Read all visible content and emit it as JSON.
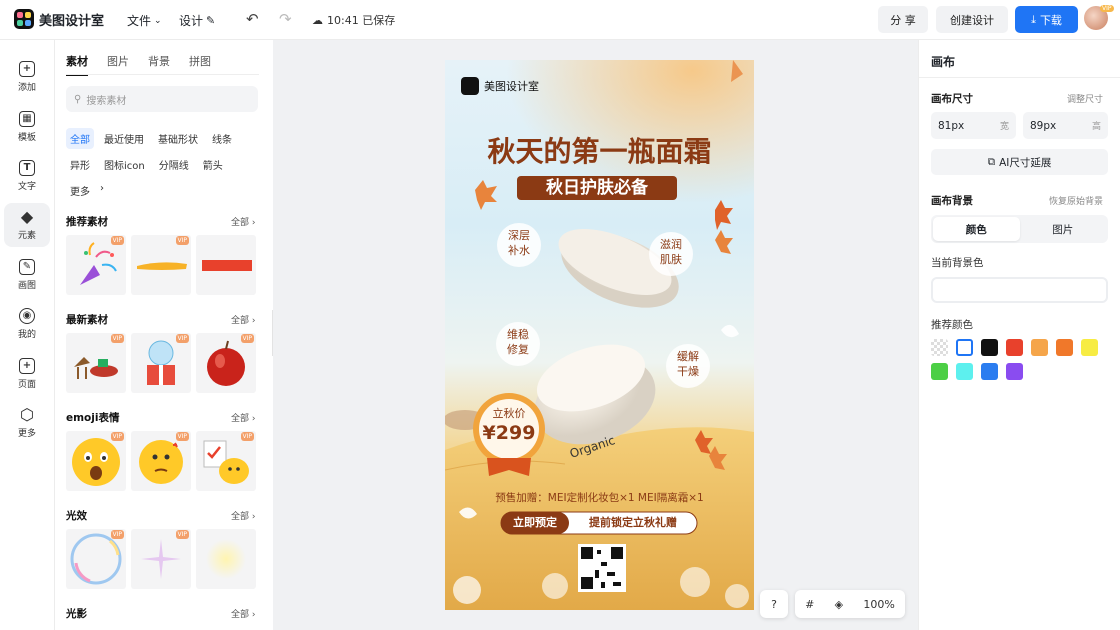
{
  "topbar": {
    "app_name": "美图设计室",
    "menu_file": "文件",
    "menu_design": "设计",
    "save_status": "10:41 已保存",
    "share_label": "分 享",
    "create_label": "创建设计",
    "download_label": "下载",
    "avatar_badge": "VIP"
  },
  "leftnav": {
    "items": [
      {
        "label": "添加",
        "icon": "+"
      },
      {
        "label": "模板",
        "icon": "▦"
      },
      {
        "label": "文字",
        "icon": "T"
      },
      {
        "label": "元素",
        "icon": "◆"
      },
      {
        "label": "画图",
        "icon": "✎"
      },
      {
        "label": "我的",
        "icon": "◉"
      },
      {
        "label": "页面",
        "icon": "+"
      },
      {
        "label": "更多",
        "icon": "⬡"
      }
    ]
  },
  "panel": {
    "tabs": [
      "素材",
      "图片",
      "背景",
      "拼图"
    ],
    "search_placeholder": "搜索素材",
    "chips_row1": [
      "全部",
      "最近使用",
      "基础形状",
      "线条"
    ],
    "chips_row2": [
      "异形",
      "图标icon",
      "分隔线",
      "箭头"
    ],
    "chips_more": "更多",
    "all_label": "全部",
    "vip": "VIP",
    "sections": [
      "推荐素材",
      "最新素材",
      "emoji表情",
      "光效",
      "光影"
    ]
  },
  "poster": {
    "brand": "美图设计室",
    "headline": "秋天的第一瓶面霜",
    "subheadline": "秋日护肤必备",
    "bubbles": [
      "深层\n补水",
      "滋润\n肌肤",
      "维稳\n修复",
      "缓解\n干燥"
    ],
    "price_label": "立秋价",
    "price": "¥299",
    "jar_text": "Organic",
    "presale": "预售加赠：MEI定制化妆包×1  MEI隔离霜×1",
    "cta_left": "立即预定",
    "cta_right": "提前锁定立秋礼赠"
  },
  "float_bar": {
    "help": "?",
    "zoom": "100%"
  },
  "rightpanel": {
    "title": "画布",
    "size_label": "画布尺寸",
    "size_adjust": "调整尺寸",
    "width_value": "81px",
    "width_unit": "宽",
    "height_value": "89px",
    "height_unit": "高",
    "ai_extend": "AI尺寸延展",
    "bg_label": "画布背景",
    "bg_restore": "恢复原始背景",
    "seg_color": "颜色",
    "seg_image": "图片",
    "current_bg": "当前背景色",
    "recommended": "推荐颜色",
    "swatches": [
      "transparent",
      "#ffffff",
      "#111111",
      "#e8412c",
      "#f5a54a",
      "#f0782a",
      "#f7ec43",
      "#4ccf45",
      "#5df0ee",
      "#2b7df0",
      "#8a4cf0"
    ]
  }
}
